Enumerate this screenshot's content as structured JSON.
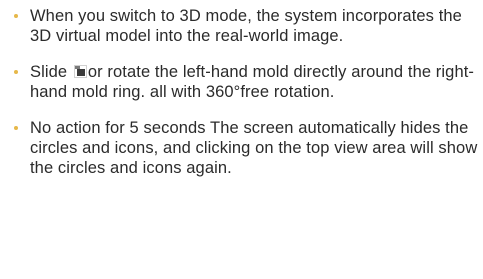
{
  "bullets": [
    {
      "text": "When you switch to 3D mode, the system incorporates the 3D virtual model into the real-world image."
    },
    {
      "text_before": "Slide ",
      "icon": "rotate-mold-icon",
      "text_after": "or rotate the left-hand mold directly around the right-hand mold ring. all with 360°free rotation."
    },
    {
      "text": "No action for 5 seconds The screen automatically hides the circles and icons, and clicking on the top view area will show the circles and icons again."
    }
  ],
  "colors": {
    "bullet": "#e6b84a",
    "text": "#2b2b2b"
  }
}
